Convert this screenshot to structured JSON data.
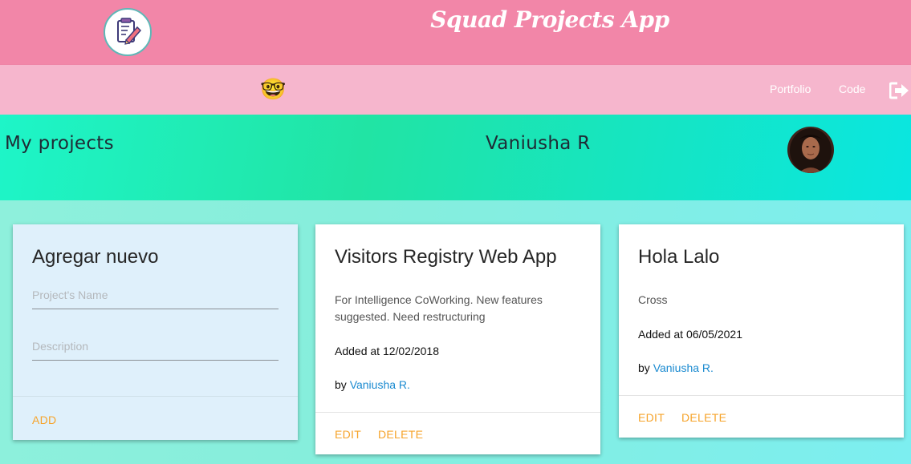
{
  "header": {
    "app_title": "Squad Projects App",
    "logo_icon": "notepad-pencil-icon"
  },
  "nav": {
    "emoji": "🤓",
    "links": [
      "Portfolio",
      "Code"
    ],
    "logout_icon": "sign-out-icon"
  },
  "hero": {
    "title": "My projects",
    "user_name": "Vaniusha R",
    "avatar_icon": "user-avatar"
  },
  "new_project": {
    "title": "Agregar nuevo",
    "name_placeholder": "Project's Name",
    "description_placeholder": "Description",
    "add_label": "ADD"
  },
  "projects": [
    {
      "title": "Visitors Registry Web App",
      "description": "For Intelligence CoWorking. New features suggested. Need restructuring",
      "added": "Added at 12/02/2018",
      "by_prefix": "by",
      "author": "Vaniusha R.",
      "edit_label": "EDIT",
      "delete_label": "DELETE"
    },
    {
      "title": "Hola Lalo",
      "description": "Cross",
      "added": "Added at 06/05/2021",
      "by_prefix": "by",
      "author": "Vaniusha R.",
      "edit_label": "EDIT",
      "delete_label": "DELETE"
    }
  ],
  "colors": {
    "topbar": "#f286a8",
    "navbar": "#f6b6cd",
    "accent_action": "#f6a32a",
    "link": "#1a8ad0"
  }
}
